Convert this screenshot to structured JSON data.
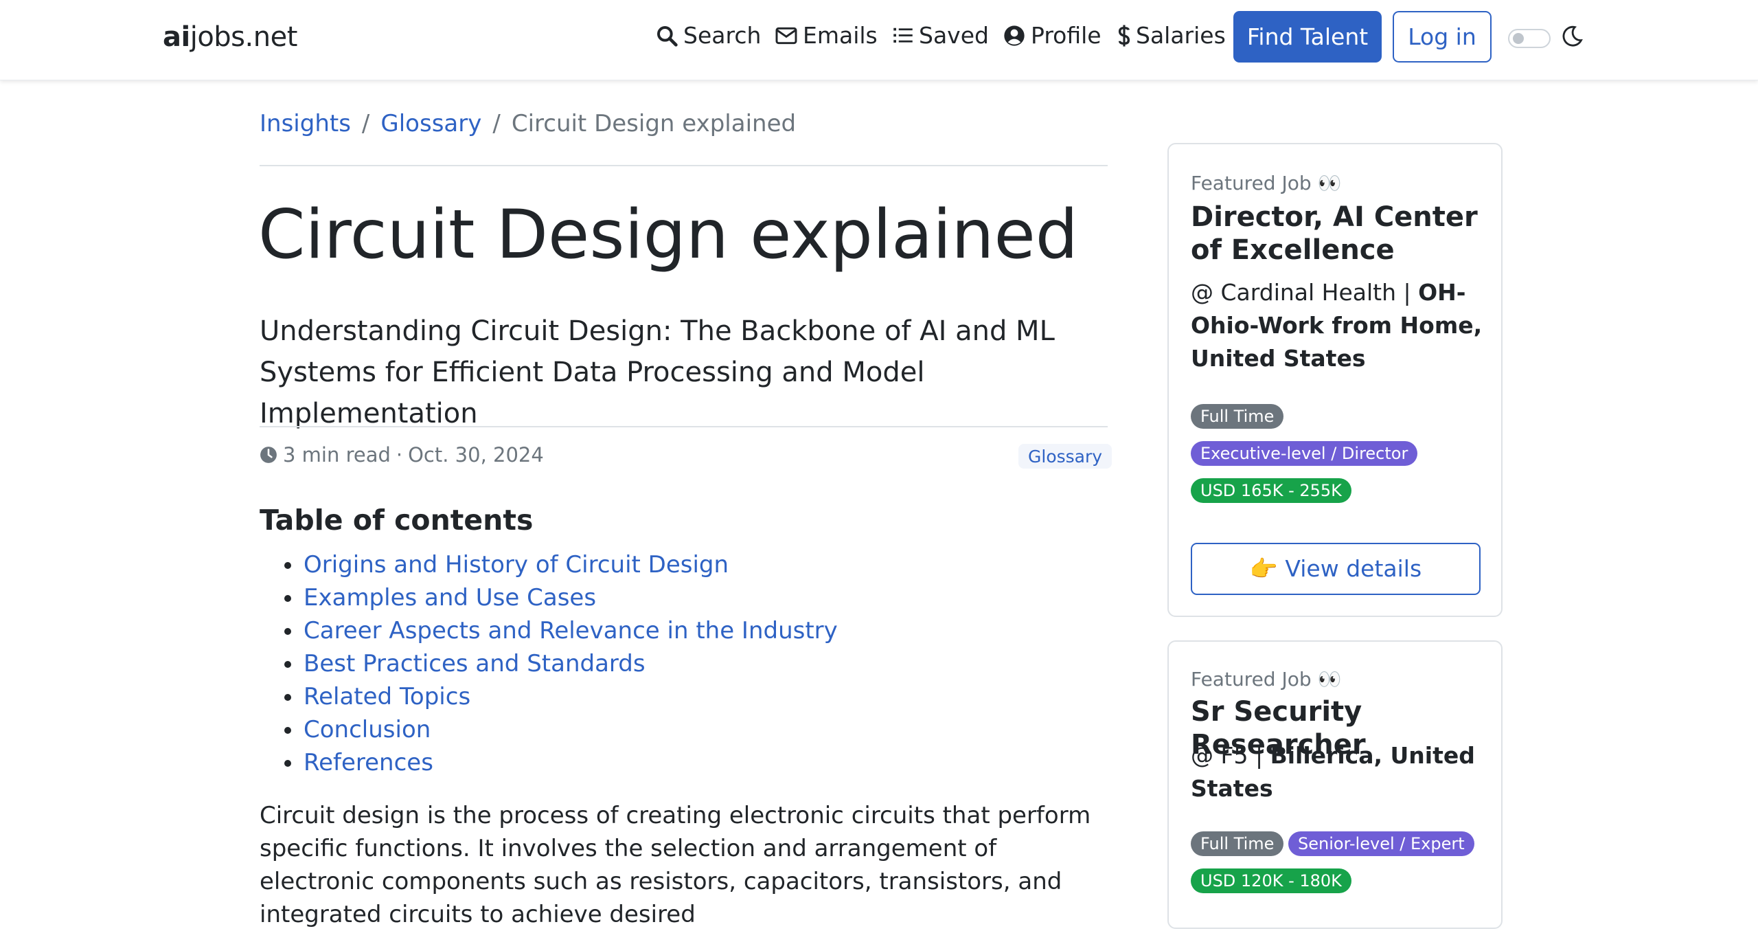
{
  "nav": {
    "brand_bold": "ai",
    "brand_rest": "jobs.net",
    "items": [
      {
        "label": "Search",
        "icon": "search-icon"
      },
      {
        "label": "Emails",
        "icon": "envelope-icon"
      },
      {
        "label": "Saved",
        "icon": "list-icon"
      },
      {
        "label": "Profile",
        "icon": "user-circle-icon"
      },
      {
        "label": "Salaries",
        "icon": "dollar-icon"
      }
    ],
    "find_talent": "Find Talent",
    "login": "Log in"
  },
  "breadcrumb": [
    "Insights",
    "Glossary",
    "Circuit Design explained"
  ],
  "article": {
    "title": "Circuit Design explained",
    "subtitle": "Understanding Circuit Design: The Backbone of AI and ML Systems for Efficient Data Processing and Model Implementation",
    "read_time": "3 min read",
    "dot": "·",
    "date": "Oct. 30, 2024",
    "tag": "Glossary",
    "toc_heading": "Table of contents",
    "toc": [
      "Origins and History of Circuit Design",
      "Examples and Use Cases",
      "Career Aspects and Relevance in the Industry",
      "Best Practices and Standards",
      "Related Topics",
      "Conclusion",
      "References"
    ],
    "body": "Circuit design is the process of creating electronic circuits that perform specific functions. It involves the selection and arrangement of electronic components such as resistors, capacitors, transistors, and integrated circuits to achieve desired"
  },
  "featured": [
    {
      "label": "Featured Job 👀",
      "title": "Director, AI Center of Excellence",
      "company": "@ Cardinal Health",
      "location": "OH-Ohio-Work from Home, United States",
      "badges": [
        {
          "text": "Full Time",
          "color": "#6c757d"
        },
        {
          "text": "Executive-level / Director",
          "color": "#6f5ed6"
        },
        {
          "text": "USD 165K - 255K",
          "color": "#17a34a"
        }
      ],
      "button": "👉 View details"
    },
    {
      "label": "Featured Job 👀",
      "title": "Sr Security Researcher",
      "company": "@ F5",
      "location": "Billerica, United States",
      "badges": [
        {
          "text": "Full Time",
          "color": "#6c757d"
        },
        {
          "text": "Senior-level / Expert",
          "color": "#6f5ed6"
        },
        {
          "text": "USD 120K - 180K",
          "color": "#17a34a"
        }
      ]
    }
  ],
  "colors": {
    "primary": "#2e62c4",
    "text": "#212529",
    "muted": "#6c757d"
  }
}
